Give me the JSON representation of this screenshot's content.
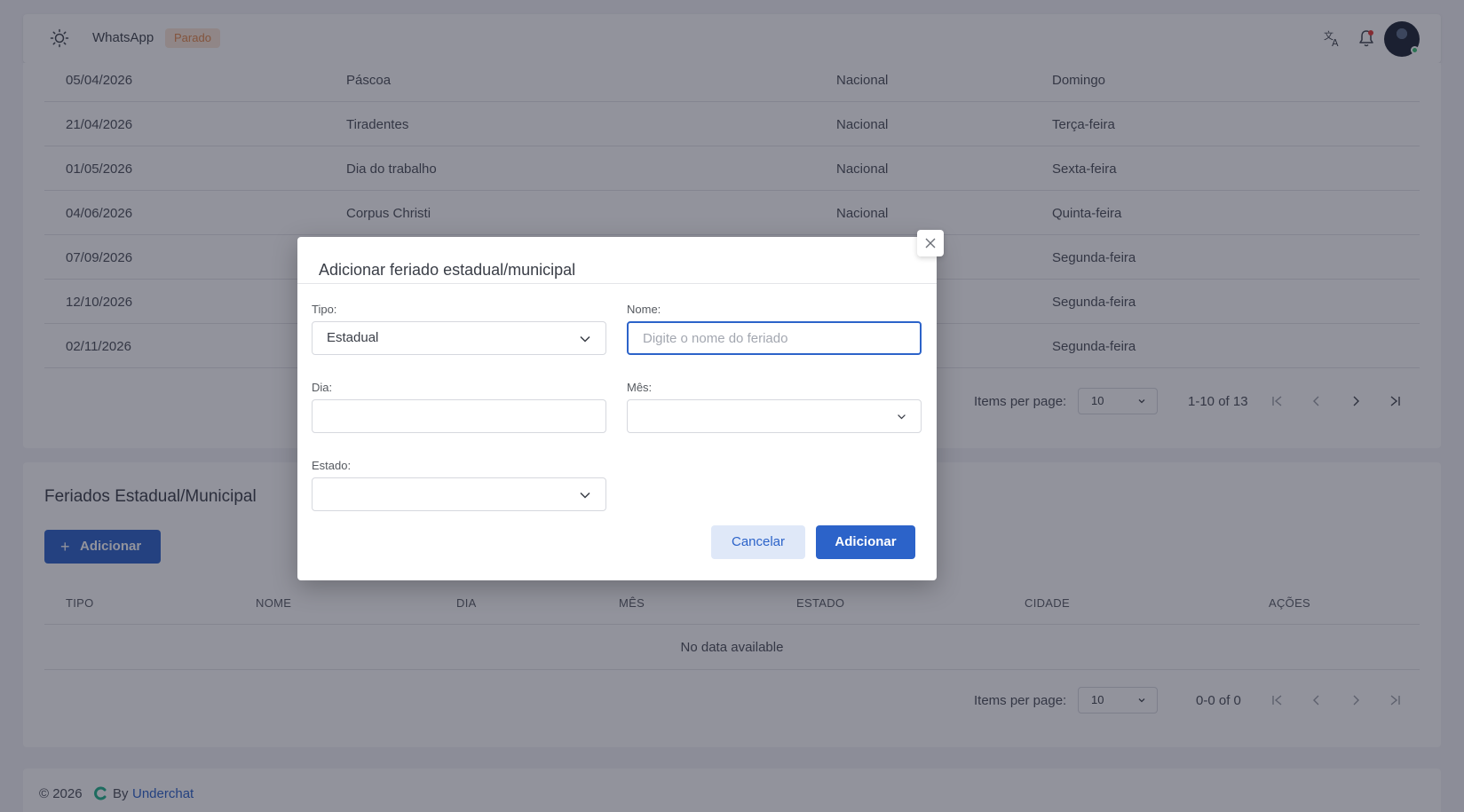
{
  "topbar": {
    "app_name": "WhatsApp",
    "status_badge": "Parado"
  },
  "national_table": {
    "rows": [
      {
        "date": "05/04/2026",
        "name": "Páscoa",
        "type": "Nacional",
        "weekday": "Domingo"
      },
      {
        "date": "21/04/2026",
        "name": "Tiradentes",
        "type": "Nacional",
        "weekday": "Terça-feira"
      },
      {
        "date": "01/05/2026",
        "name": "Dia do trabalho",
        "type": "Nacional",
        "weekday": "Sexta-feira"
      },
      {
        "date": "04/06/2026",
        "name": "Corpus Christi",
        "type": "Nacional",
        "weekday": "Quinta-feira"
      },
      {
        "date": "07/09/2026",
        "name": "",
        "type": "",
        "weekday": "Segunda-feira"
      },
      {
        "date": "12/10/2026",
        "name": "",
        "type": "",
        "weekday": "Segunda-feira"
      },
      {
        "date": "02/11/2026",
        "name": "",
        "type": "",
        "weekday": "Segunda-feira"
      }
    ],
    "pagination": {
      "items_per_page_label": "Items per page:",
      "items_per_page_value": "10",
      "range": "1-10 of 13"
    }
  },
  "state_card": {
    "title": "Feriados Estadual/Municipal",
    "add_button": "Adicionar",
    "columns": [
      "TIPO",
      "NOME",
      "DIA",
      "MÊS",
      "ESTADO",
      "CIDADE",
      "AÇÕES"
    ],
    "empty_text": "No data available",
    "pagination": {
      "items_per_page_label": "Items per page:",
      "items_per_page_value": "10",
      "range": "0-0 of 0"
    }
  },
  "footer": {
    "copyright": "© 2026",
    "by": "By",
    "link": "Underchat"
  },
  "dialog": {
    "title": "Adicionar feriado estadual/municipal",
    "tipo_label": "Tipo:",
    "tipo_value": "Estadual",
    "nome_label": "Nome:",
    "nome_placeholder": "Digite o nome do feriado",
    "dia_label": "Dia:",
    "dia_value": "",
    "mes_label": "Mês:",
    "mes_value": "",
    "estado_label": "Estado:",
    "estado_value": "",
    "cancel_button": "Cancelar",
    "add_button": "Adicionar"
  },
  "colors": {
    "primary": "#2c63c9",
    "badge_bg": "#fbe7d6",
    "badge_text": "#e2874a",
    "online": "#39c172"
  }
}
